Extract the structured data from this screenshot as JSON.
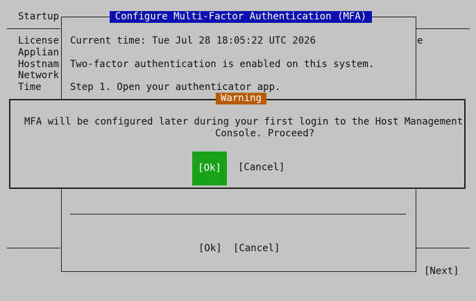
{
  "background": {
    "title": "Startup",
    "sidebar_items": [
      "License",
      "Applian",
      "Hostnam",
      "Network",
      "Time"
    ],
    "side_text": "e",
    "next_label": "[Next]"
  },
  "mfa_dialog": {
    "title": "Configure Multi-Factor Authentication (MFA)",
    "lines": [
      "Current time: Tue Jul 28 18:05:22 UTC 2026",
      "Two-factor authentication is enabled on this system.",
      "Step 1. Open your authenticator app."
    ],
    "ok_label": "[Ok]",
    "cancel_label": "[Cancel]"
  },
  "warning_dialog": {
    "title": "Warning",
    "message_line1": "MFA will be configured later during your first login to the Host Management",
    "message_line2": "Console. Proceed?",
    "ok_label": "[Ok]",
    "cancel_label": "[Cancel]"
  },
  "colors": {
    "background": "#c4c4c4",
    "mfa_title_bg": "#0b0fb0",
    "warning_title_bg": "#b75b05",
    "focused_button_bg": "#19a219"
  }
}
